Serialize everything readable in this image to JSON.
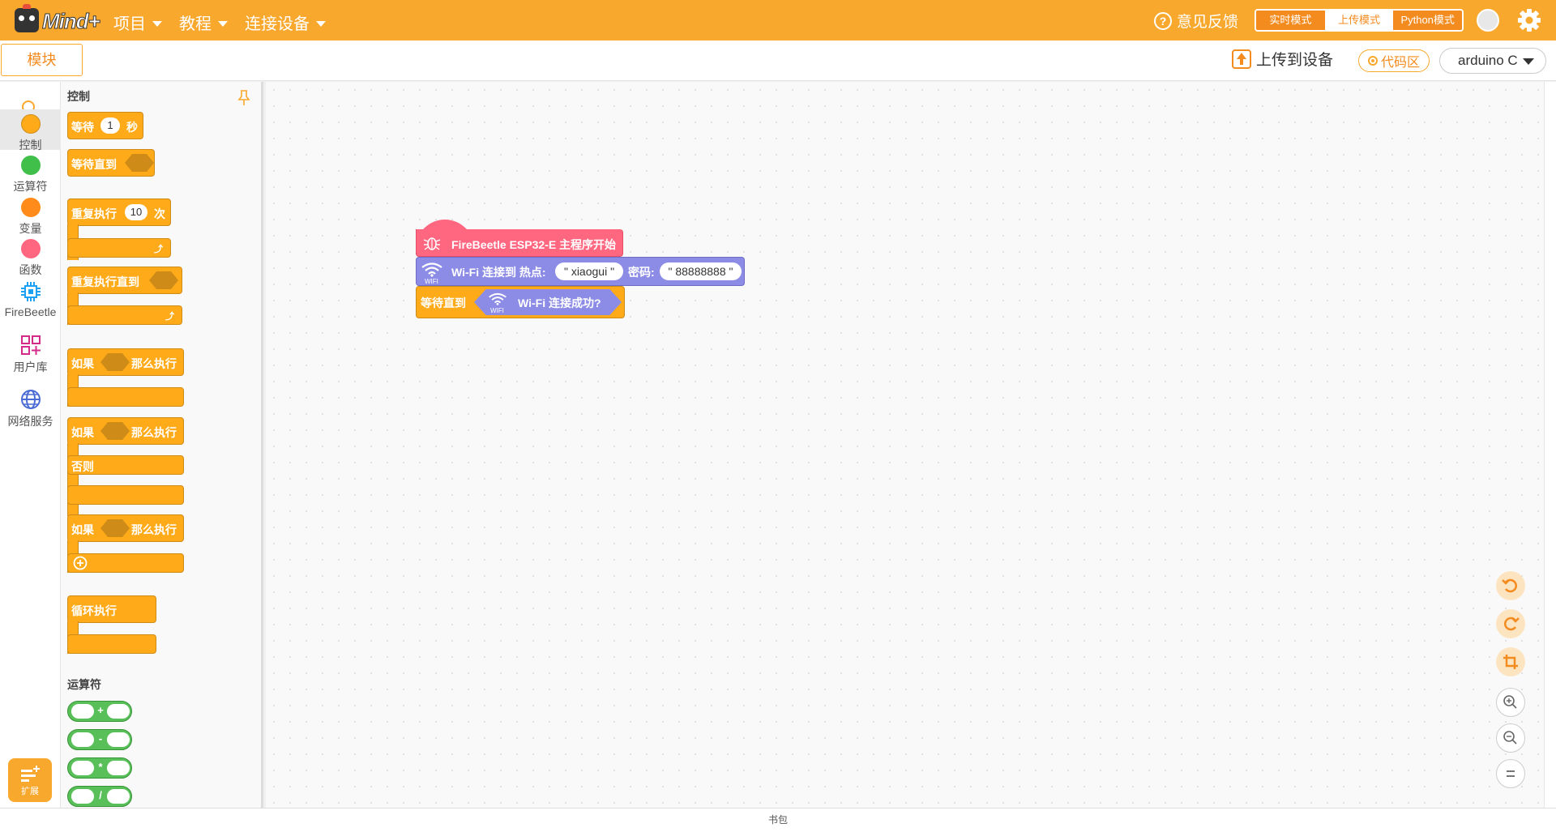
{
  "app": {
    "brand": "Mind+",
    "menus": [
      "项目",
      "教程",
      "连接设备"
    ],
    "feedback": "意见反馈",
    "modes": [
      "实时模式",
      "上传模式",
      "Python模式"
    ],
    "active_mode": "上传模式"
  },
  "toolbar": {
    "blocks_tab": "模块",
    "upload": "上传到设备",
    "code_area": "代码区",
    "language": "arduino C"
  },
  "categories": [
    {
      "label": "控制",
      "color": "#ffab19"
    },
    {
      "label": "运算符",
      "color": "#40bf4a"
    },
    {
      "label": "变量",
      "color": "#ff8c1a"
    },
    {
      "label": "函数",
      "color": "#ff6680"
    },
    {
      "label": "FireBeetle",
      "icon": "chip-icon"
    },
    {
      "label": "用户库",
      "icon": "library-icon"
    },
    {
      "label": "网络服务",
      "icon": "globe-icon"
    }
  ],
  "extension_button": "扩展",
  "flyout": {
    "control_title": "控制",
    "operators_title": "运算符",
    "wait": {
      "label": "等待",
      "value": "1",
      "unit": "秒"
    },
    "wait_until": "等待直到",
    "repeat": {
      "label": "重复执行",
      "value": "10",
      "unit": "次"
    },
    "repeat_until": "重复执行直到",
    "if_then": {
      "if": "如果",
      "then": "那么执行"
    },
    "else": "否则",
    "forever": "循环执行",
    "operators": [
      "+",
      "-",
      "*",
      "/"
    ]
  },
  "workspace": {
    "hat": "FireBeetle ESP32-E 主程序开始",
    "wifi_connect": {
      "label": "Wi-Fi 连接到 热点:",
      "ssid": "xiaogui",
      "pwd_label": "密码:",
      "pwd": "88888888"
    },
    "wait_until": "等待直到",
    "wifi_connected": "Wi-Fi 连接成功?",
    "wifi_icon_text": "WIFI"
  },
  "backpack": "书包"
}
